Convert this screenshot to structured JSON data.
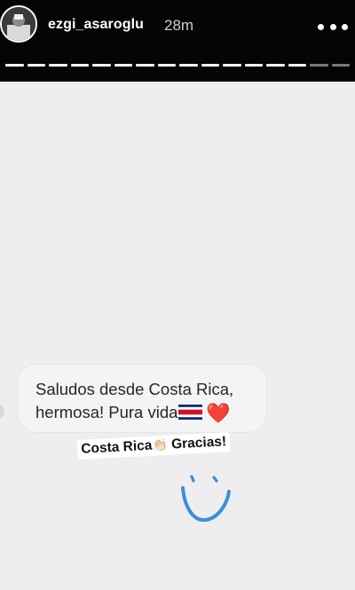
{
  "header": {
    "username": "ezgi_asaroglu",
    "timestamp": "28m",
    "more_icon": "more-horizontal-icon",
    "story_segments": {
      "total": 16,
      "viewed": 14
    }
  },
  "reply_bubble": {
    "line1": "Saludos desde Costa Rica,",
    "line2": "hermosa! Pura vida",
    "flag_icon": "costa-rica-flag-icon",
    "heart": "❤️"
  },
  "caption": {
    "part1": "Costa Rica",
    "emoji": "👏🏻",
    "part2": "Gracias!"
  },
  "drawing": {
    "icon": "smiley-doodle-icon",
    "color": "#3a8fd9"
  },
  "colors": {
    "header_bg": "#050505",
    "story_bg": "#eeeeee",
    "heart": "#e0245e"
  }
}
